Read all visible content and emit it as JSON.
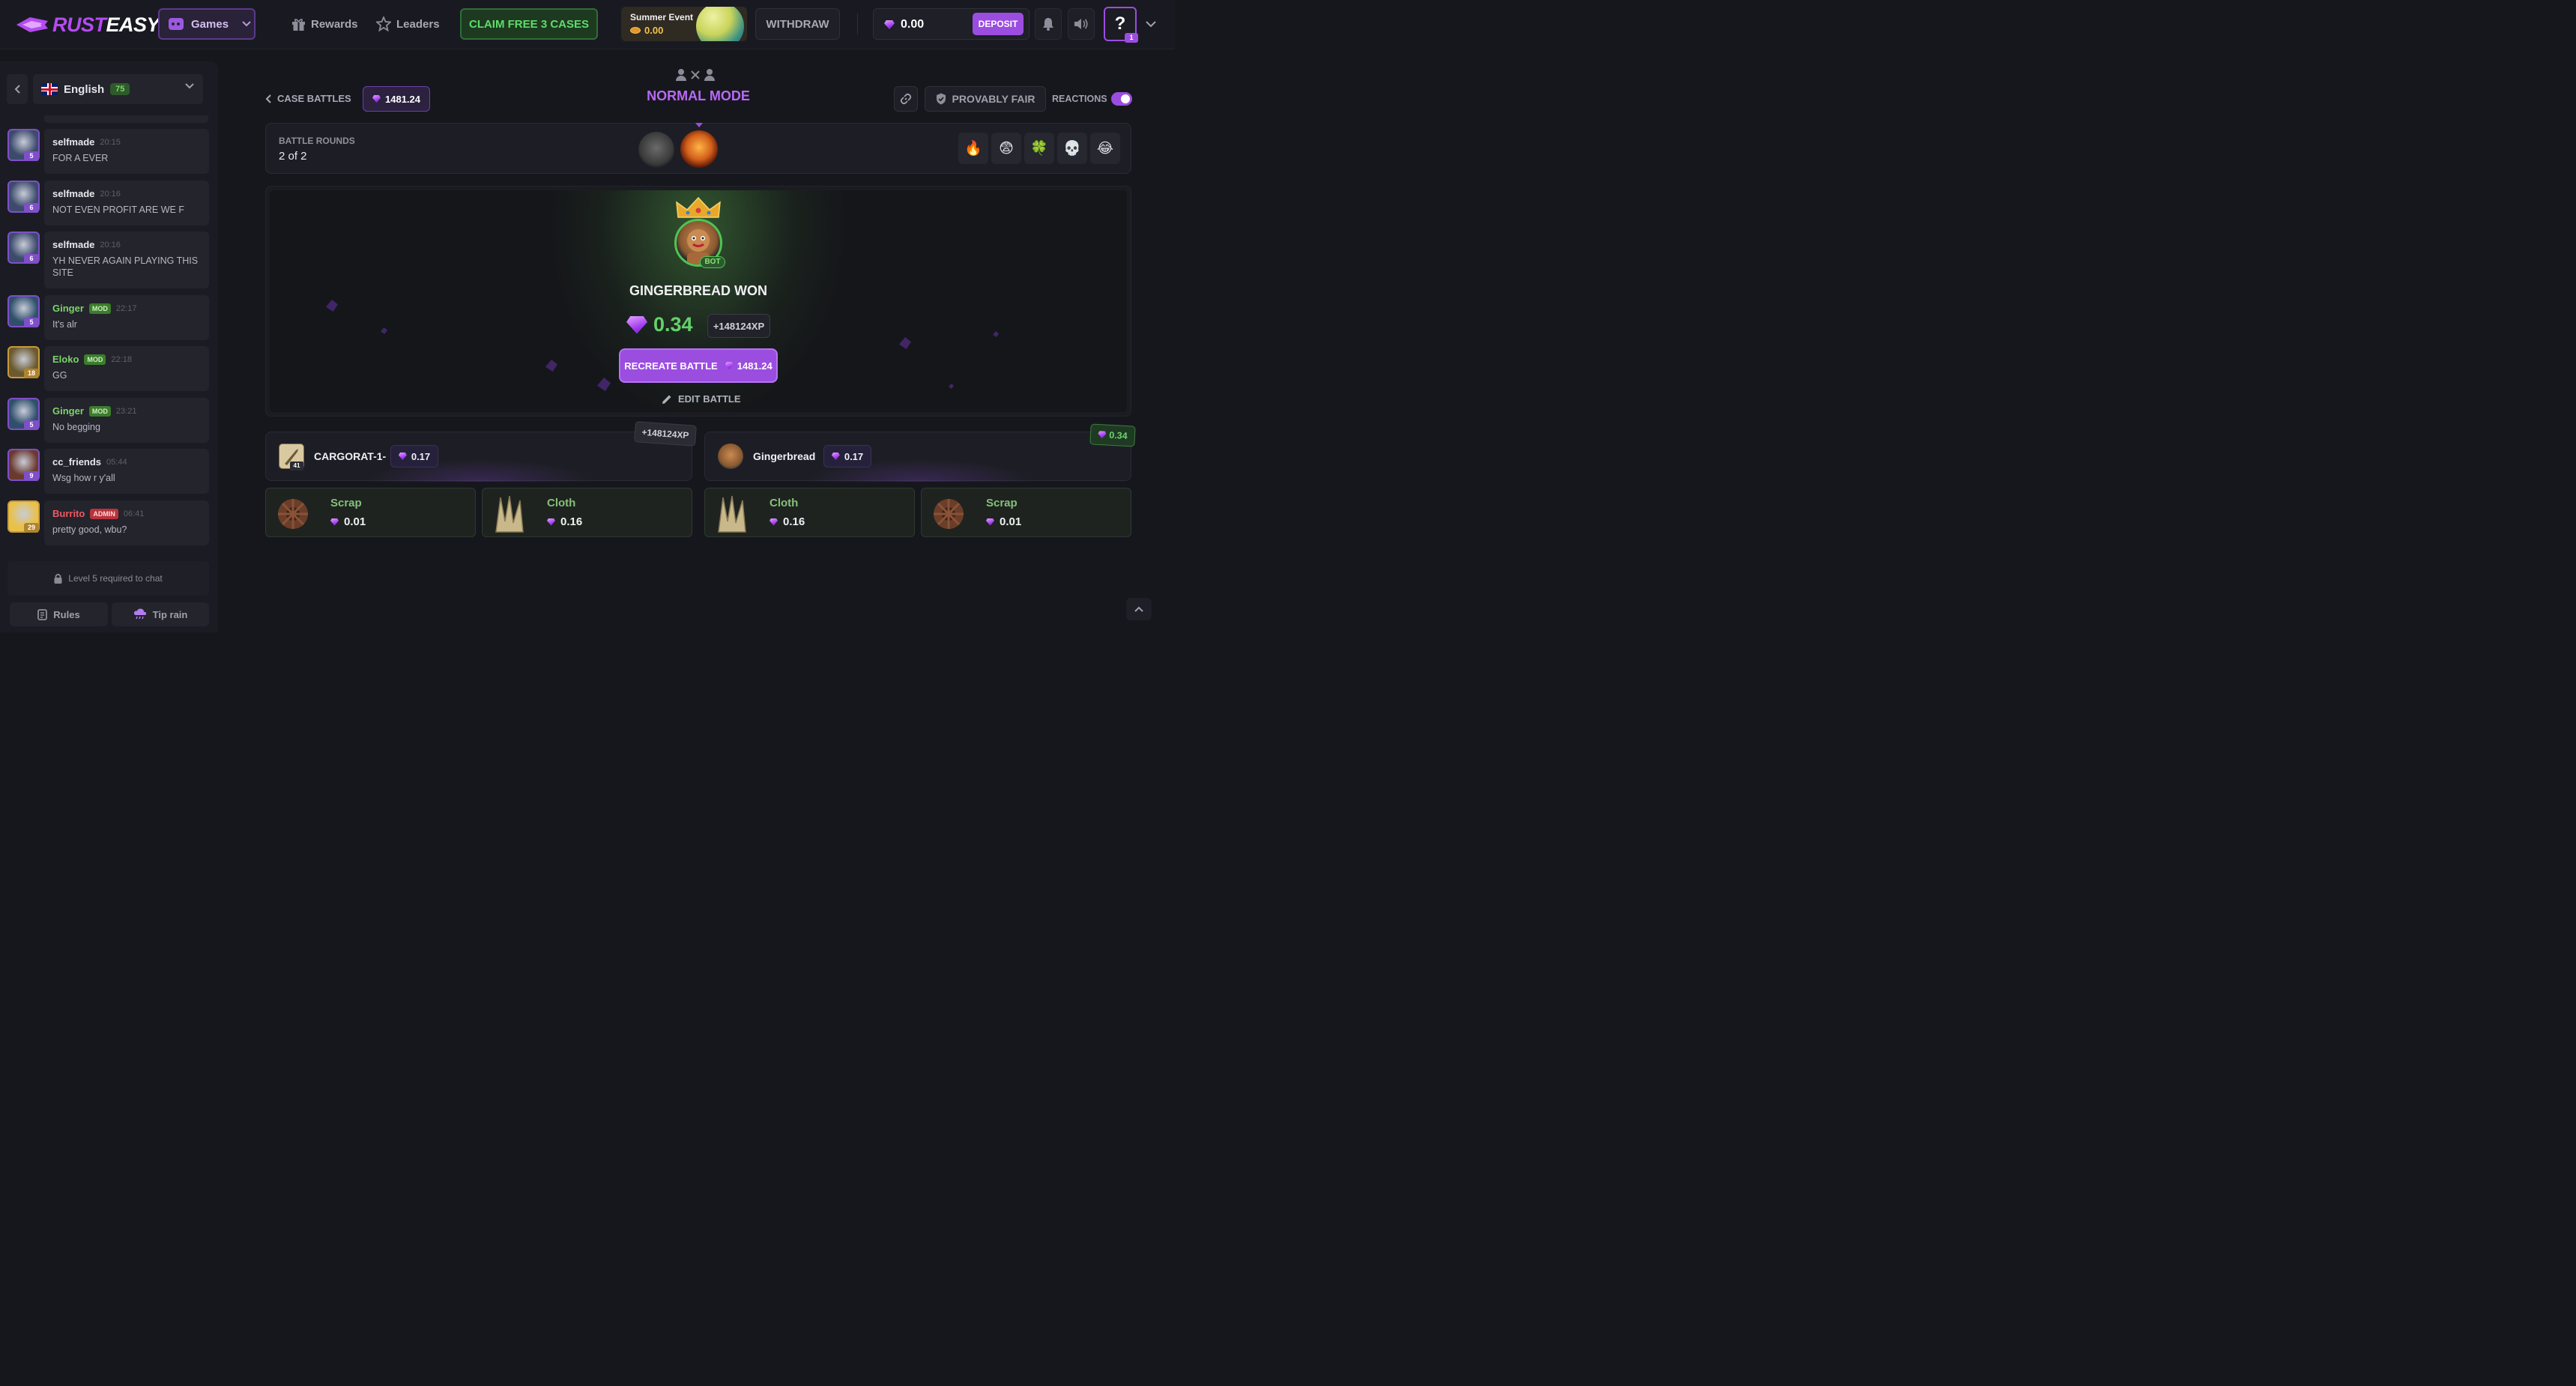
{
  "header": {
    "logo_rust": "RUST",
    "logo_easy": "EASY",
    "games_label": "Games",
    "rewards_label": "Rewards",
    "leaders_label": "Leaders",
    "claim_label": "CLAIM FREE 3 CASES",
    "event_title": "Summer Event",
    "event_value": "0.00",
    "withdraw_label": "WITHDRAW",
    "balance": "0.00",
    "deposit_label": "DEPOSIT",
    "help_label": "?",
    "help_badge": "1"
  },
  "chat": {
    "language": "English",
    "language_count": "75",
    "messages": [
      {
        "user": "selfmade",
        "time": "20:15",
        "text": "FOR A EVER",
        "level": "5",
        "role": ""
      },
      {
        "user": "selfmade",
        "time": "20:16",
        "text": "NOT EVEN PROFIT ARE WE F",
        "level": "6",
        "role": ""
      },
      {
        "user": "selfmade",
        "time": "20:16",
        "text": "YH NEVER AGAIN PLAYING THIS SITE",
        "level": "6",
        "role": ""
      },
      {
        "user": "Ginger",
        "time": "22:17",
        "text": "It's alr",
        "level": "5",
        "role": "MOD"
      },
      {
        "user": "Eloko",
        "time": "22:18",
        "text": "GG",
        "level": "18",
        "role": "MOD"
      },
      {
        "user": "Ginger",
        "time": "23:21",
        "text": "No begging",
        "level": "5",
        "role": "MOD"
      },
      {
        "user": "cc_friends",
        "time": "05:44",
        "text": "Wsg how r y'all",
        "level": "9",
        "role": ""
      },
      {
        "user": "Burrito",
        "time": "06:41",
        "text": "pretty good, wbu?",
        "level": "29",
        "role": "ADMIN"
      }
    ],
    "level_required": "Level 5 required to chat",
    "rules_label": "Rules",
    "tip_rain_label": "Tip rain"
  },
  "battle": {
    "breadcrumb": "CASE BATTLES",
    "price": "1481.24",
    "mode": "NORMAL MODE",
    "provably_fair": "PROVABLY FAIR",
    "reactions_label": "REACTIONS",
    "rounds_label": "BATTLE ROUNDS",
    "rounds_value": "2 of 2",
    "emojis": [
      "🔥",
      "😨",
      "🍀",
      "💀",
      "😂"
    ],
    "winner_tag": "BOT",
    "winner_text": "GINGERBREAD WON",
    "won_amount": "0.34",
    "won_xp": "+148124XP",
    "recreate_label": "RECREATE BATTLE",
    "recreate_price": "1481.24",
    "edit_label": "EDIT BATTLE"
  },
  "players": [
    {
      "name": "CARGORAT-1-",
      "value": "0.17",
      "level": "41",
      "float_tag": "+148124XP",
      "items": [
        {
          "name": "Scrap",
          "value": "0.01"
        },
        {
          "name": "Cloth",
          "value": "0.16"
        }
      ]
    },
    {
      "name": "Gingerbread",
      "value": "0.17",
      "level": "",
      "float_tag": "0.34",
      "items": [
        {
          "name": "Cloth",
          "value": "0.16"
        },
        {
          "name": "Scrap",
          "value": "0.01"
        }
      ]
    }
  ],
  "colors": {
    "accent": "#9b4de0",
    "success": "#64d26a",
    "background": "#16171d"
  }
}
